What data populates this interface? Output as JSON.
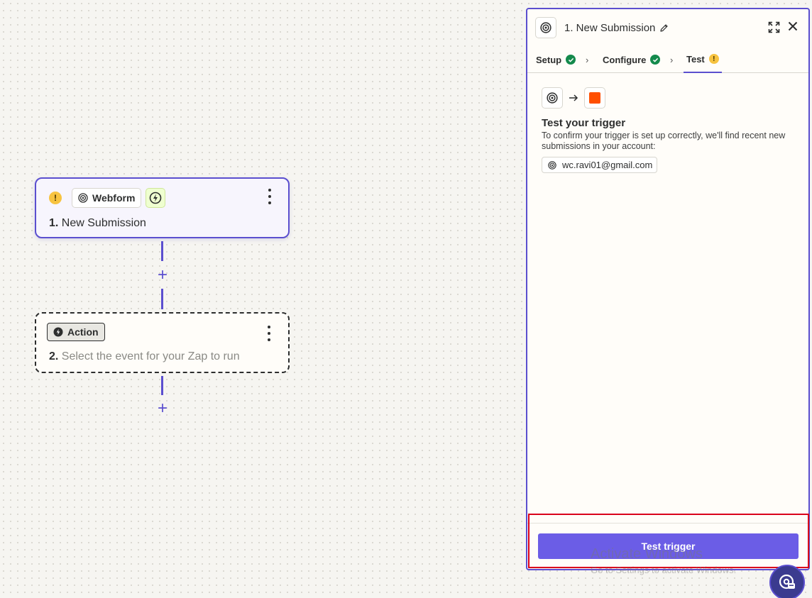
{
  "canvas": {
    "trigger_step": {
      "app_name": "Webform",
      "number": "1.",
      "title": "New Submission"
    },
    "action_step": {
      "chip_label": "Action",
      "number": "2.",
      "title": "Select the event for your Zap to run"
    }
  },
  "panel": {
    "title": "1. New Submission",
    "tabs": [
      {
        "label": "Setup",
        "status": "complete"
      },
      {
        "label": "Configure",
        "status": "complete"
      },
      {
        "label": "Test",
        "status": "warning"
      }
    ],
    "heading": "Test your trigger",
    "description": "To confirm your trigger is set up correctly, we'll find recent new submissions in your account:",
    "account": "wc.ravi01@gmail.com",
    "button_label": "Test trigger"
  },
  "watermark": {
    "title": "Activate Windows",
    "subtitle": "Go to Settings to activate Windows."
  },
  "colors": {
    "accent": "#5b4fcf",
    "button": "#6b5de6",
    "success": "#148a4c",
    "warning": "#f7c340",
    "highlight": "#d9001b",
    "destination_app": "#ff4f00"
  }
}
